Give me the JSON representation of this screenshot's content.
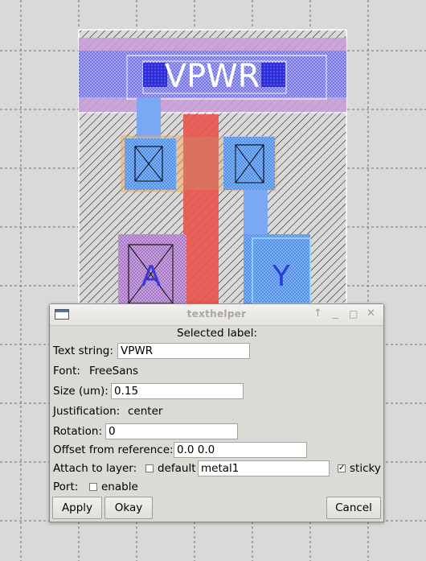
{
  "layout": {
    "pin_label": "VPWR",
    "port_labels": [
      "A",
      "Y"
    ]
  },
  "dialog": {
    "title": "texthelper",
    "window_buttons": [
      "↑",
      "_",
      "□",
      "✕"
    ],
    "heading": "Selected label:",
    "text_string_label": "Text string:",
    "text_string_value": "VPWR",
    "font_label": "Font:",
    "font_value": "FreeSans",
    "size_label": "Size (um):",
    "size_value": "0.15",
    "justification_label": "Justification:",
    "justification_value": "center",
    "rotation_label": "Rotation:",
    "rotation_value": "0",
    "offset_label": "Offset from reference:",
    "offset_value": "0.0 0.0",
    "attach_label": "Attach to layer:",
    "default_label": "default",
    "default_checked": false,
    "layer_value": "metal1",
    "sticky_label": "sticky",
    "sticky_checked": true,
    "port_label": "Port:",
    "enable_label": "enable",
    "enable_checked": false,
    "apply_label": "Apply",
    "okay_label": "Okay",
    "cancel_label": "Cancel"
  },
  "colors": {
    "metal_blue": "#8c8cf4",
    "poly_red": "#e8564f",
    "local_blue": "#6a9cf4",
    "grid": "#6f6f6f"
  }
}
